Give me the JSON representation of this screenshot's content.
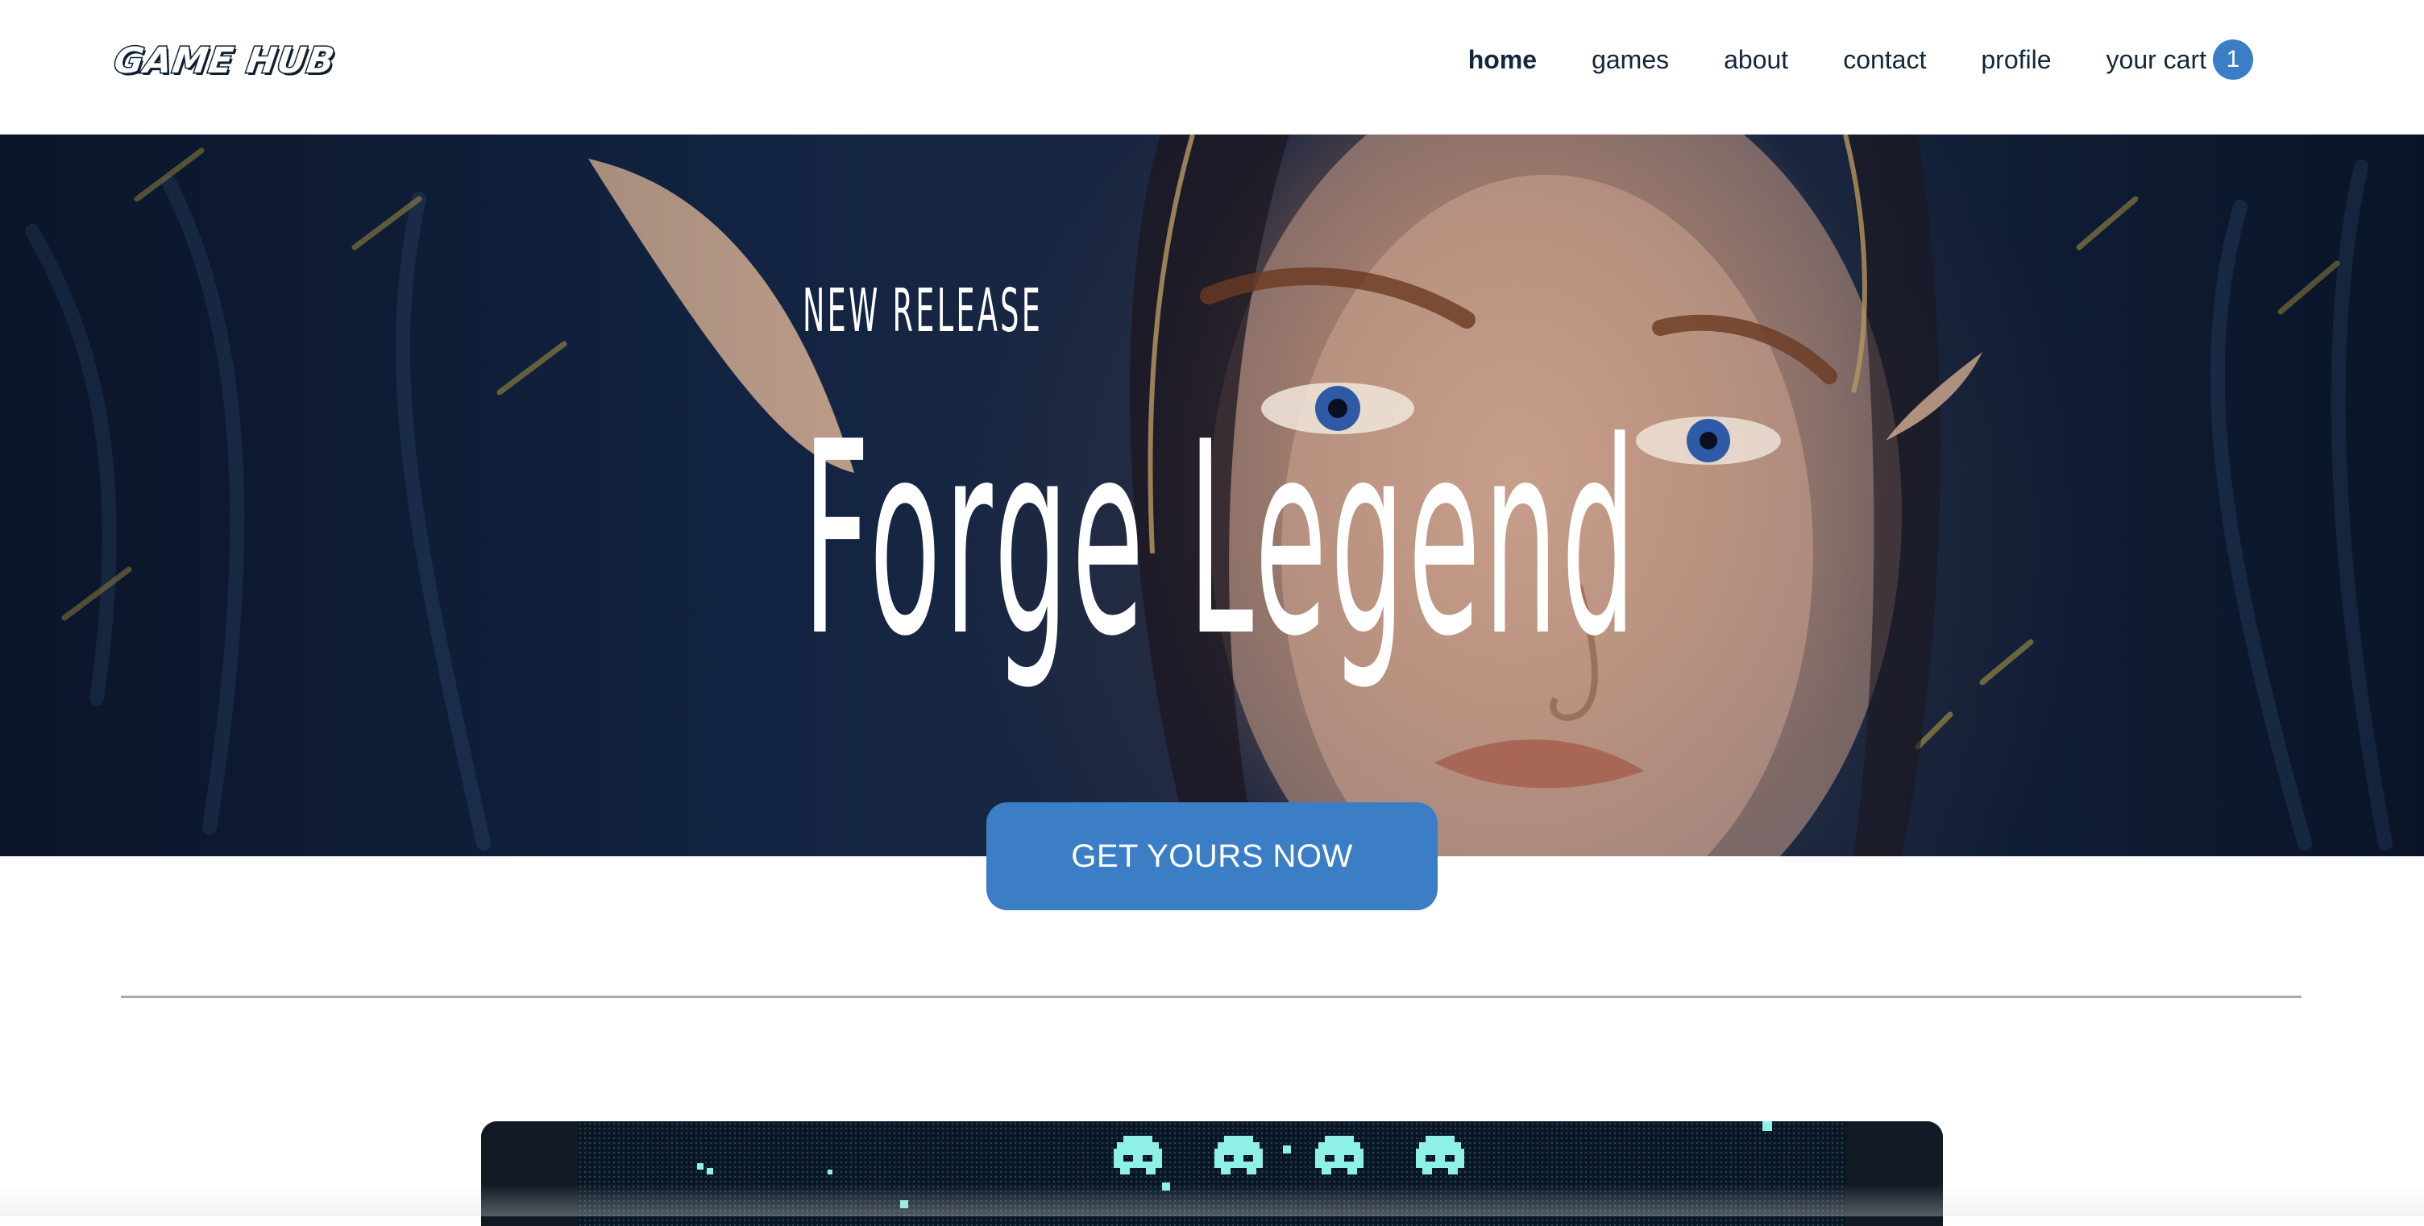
{
  "header": {
    "logo_text": "GAME HUB",
    "nav": [
      {
        "label": "home",
        "active": true
      },
      {
        "label": "games",
        "active": false
      },
      {
        "label": "about",
        "active": false
      },
      {
        "label": "contact",
        "active": false
      },
      {
        "label": "profile",
        "active": false
      }
    ],
    "cart_label": "your cart",
    "cart_count": "1"
  },
  "hero": {
    "eyebrow": "NEW RELEASE",
    "title": "Forge Legend",
    "cta_label": "GET YOURS NOW"
  },
  "colors": {
    "accent": "#3b7ec6",
    "text_dark": "#13263a",
    "divider": "#a9a9a9"
  },
  "icons": {
    "invader": "space-invader-icon"
  }
}
